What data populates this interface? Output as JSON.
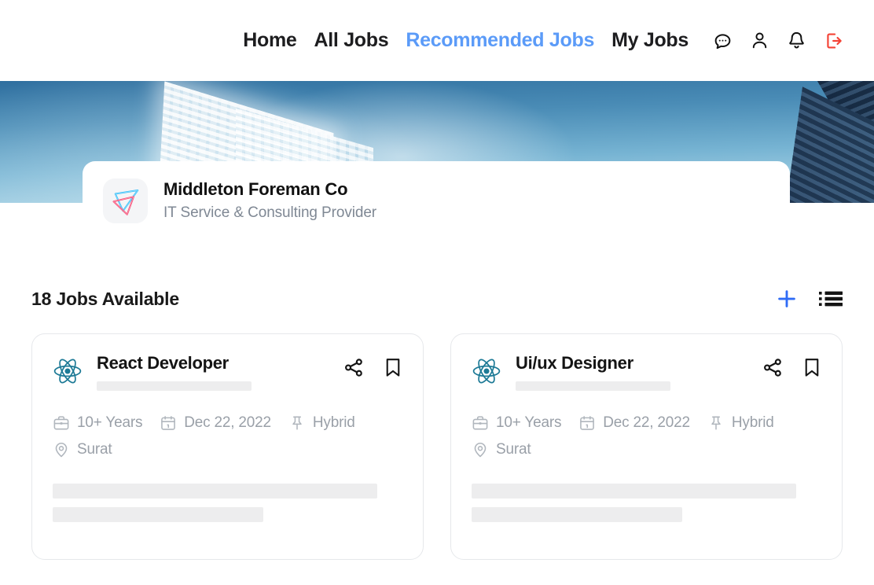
{
  "nav": {
    "links": [
      {
        "label": "Home",
        "active": false
      },
      {
        "label": "All Jobs",
        "active": false
      },
      {
        "label": "Recommended Jobs",
        "active": true
      },
      {
        "label": "My Jobs",
        "active": false
      }
    ],
    "icons": [
      {
        "name": "chat-icon"
      },
      {
        "name": "user-icon"
      },
      {
        "name": "notification-bell-icon"
      },
      {
        "name": "logout-icon"
      }
    ],
    "active_color": "#5b9bf8",
    "logout_color": "#f44336"
  },
  "company": {
    "name": "Middleton Foreman Co",
    "tagline": "IT Service & Consulting Provider",
    "logo_name": "company-logo-icon"
  },
  "jobs_section": {
    "count_label": "18 Jobs Available",
    "add_icon": "plus-icon",
    "add_icon_color": "#2f6cf6",
    "list_icon": "list-view-icon",
    "list_icon_color": "#141414"
  },
  "jobs": [
    {
      "title": "React Developer",
      "logo_name": "react-logo-icon",
      "logo_color": "#1d7a96",
      "share_icon": "share-icon",
      "bookmark_icon": "bookmark-icon",
      "meta": [
        {
          "icon": "briefcase-icon",
          "text": "10+ Years"
        },
        {
          "icon": "calendar-icon",
          "text": "Dec 22, 2022"
        },
        {
          "icon": "pin-icon",
          "text": "Hybrid"
        },
        {
          "icon": "location-icon",
          "text": "Surat"
        }
      ]
    },
    {
      "title": "Ui/ux Designer",
      "logo_name": "react-logo-icon",
      "logo_color": "#1d7a96",
      "share_icon": "share-icon",
      "bookmark_icon": "bookmark-icon",
      "meta": [
        {
          "icon": "briefcase-icon",
          "text": "10+ Years"
        },
        {
          "icon": "calendar-icon",
          "text": "Dec 22, 2022"
        },
        {
          "icon": "pin-icon",
          "text": "Hybrid"
        },
        {
          "icon": "location-icon",
          "text": "Surat"
        }
      ]
    }
  ]
}
